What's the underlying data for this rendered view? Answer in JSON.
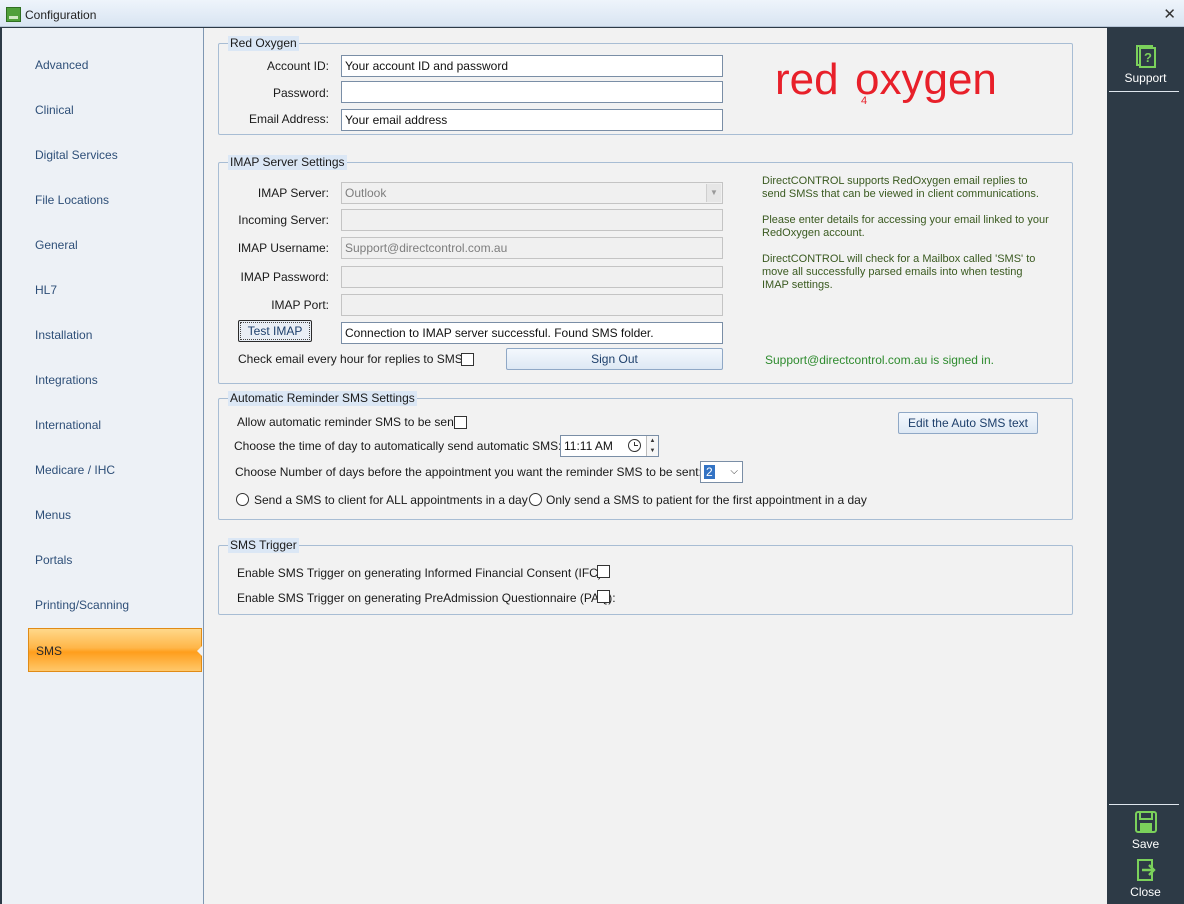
{
  "window": {
    "title": "Configuration",
    "close_glyph": "✕"
  },
  "sidebar": {
    "items": [
      {
        "label": "Advanced"
      },
      {
        "label": "Clinical"
      },
      {
        "label": "Digital Services"
      },
      {
        "label": "File Locations"
      },
      {
        "label": "General"
      },
      {
        "label": "HL7"
      },
      {
        "label": "Installation"
      },
      {
        "label": "Integrations"
      },
      {
        "label": "International"
      },
      {
        "label": "Medicare / IHC"
      },
      {
        "label": "Menus"
      },
      {
        "label": "Portals"
      },
      {
        "label": "Printing/Scanning"
      },
      {
        "label": "SMS"
      }
    ],
    "active": "SMS"
  },
  "red_oxygen": {
    "title": "Red Oxygen",
    "account_id_label": "Account ID:",
    "account_id_value": "Your account ID and password",
    "password_label": "Password:",
    "password_value": "",
    "email_label": "Email Address:",
    "email_value": "Your email address",
    "logo": {
      "part1": "red",
      "part2": "oxygen",
      "mark": "4"
    }
  },
  "imap": {
    "title": "IMAP Server Settings",
    "server_label": "IMAP Server:",
    "server_value": "Outlook",
    "incoming_label": "Incoming Server:",
    "incoming_value": "",
    "username_label": "IMAP Username:",
    "username_value": "Support@directcontrol.com.au",
    "password_label": "IMAP Password:",
    "password_value": "",
    "port_label": "IMAP Port:",
    "port_value": "",
    "test_button": "Test IMAP",
    "test_result": "Connection to IMAP server successful. Found SMS folder.",
    "check_hourly_label": "Check email every hour for replies to SMS's",
    "sign_out_button": "Sign Out",
    "signed_in_status": "Support@directcontrol.com.au is signed in.",
    "info1_line1": "DirectCONTROL supports RedOxygen email replies to",
    "info1_line2": "send SMSs that can be viewed in client communications.",
    "info2_line1": "Please enter details for accessing your email linked to your",
    "info2_line2": "RedOxygen account.",
    "info3_line1": "DirectCONTROL will check for a Mailbox called 'SMS' to",
    "info3_line2": "move all successfully parsed emails into when testing",
    "info3_line3": "IMAP settings."
  },
  "auto_reminder": {
    "title": "Automatic Reminder SMS Settings",
    "allow_label": "Allow automatic reminder SMS to be sent",
    "edit_button": "Edit the Auto SMS text",
    "time_label": "Choose the time of day to automatically send automatic SMS:",
    "time_value": "11:11 AM",
    "days_label": "Choose Number of days before the appointment you want the reminder SMS to be sent:",
    "days_value": "2",
    "radio_all_label": "Send a SMS to client for ALL appointments in a day",
    "radio_first_label": "Only send a SMS to patient for the first appointment in a day"
  },
  "sms_trigger": {
    "title": "SMS Trigger",
    "ifc_label": "Enable SMS Trigger on generating Informed Financial Consent (IFC):",
    "paq_label": "Enable SMS Trigger on generating PreAdmission Questionnaire (PAQ):"
  },
  "rightbar": {
    "support_label": "Support",
    "save_label": "Save",
    "close_label": "Close"
  },
  "colors": {
    "accent_orange": "#ffb648",
    "sidebar_text": "#2e4f78",
    "dark_panel": "#2d3a46",
    "logo_red": "#e8202a",
    "success_green": "#2e8b2e"
  }
}
